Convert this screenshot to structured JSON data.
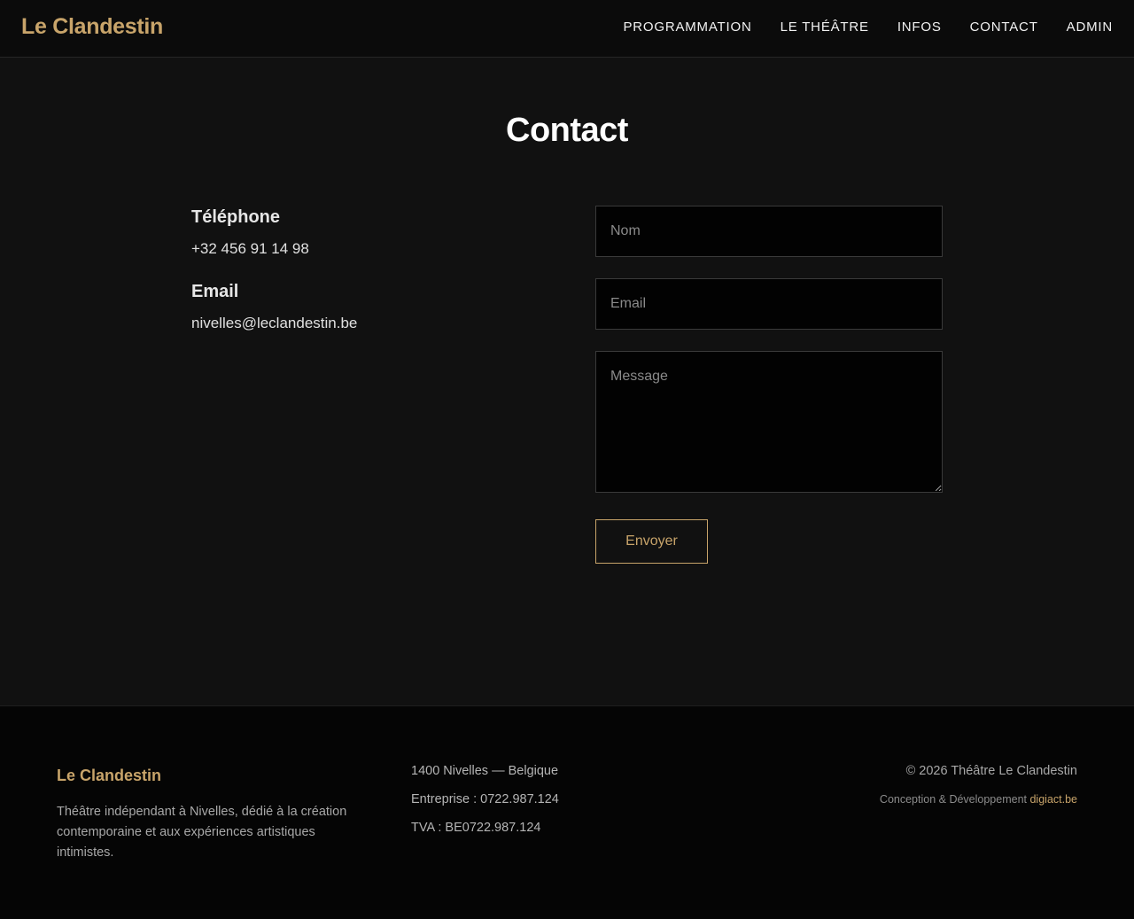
{
  "header": {
    "brand": "Le Clandestin",
    "nav": [
      "PROGRAMMATION",
      "LE THÉÂTRE",
      "INFOS",
      "CONTACT",
      "ADMIN"
    ]
  },
  "page": {
    "title": "Contact"
  },
  "contact_info": {
    "phone_heading": "Téléphone",
    "phone_value": "+32 456 91 14 98",
    "email_heading": "Email",
    "email_value": "nivelles@leclandestin.be"
  },
  "form": {
    "name_placeholder": "Nom",
    "email_placeholder": "Email",
    "message_placeholder": "Message",
    "submit_label": "Envoyer"
  },
  "footer": {
    "brand": "Le Clandestin",
    "description": "Théâtre indépendant à Nivelles, dédié à la création contemporaine et aux expériences artistiques intimistes.",
    "address": "1400 Nivelles — Belgique",
    "company": "Entreprise : 0722.987.124",
    "vat": "TVA : BE0722.987.124",
    "copyright": "© 2026 Théâtre Le Clandestin",
    "credits_prefix": "Conception & Développement",
    "credits_link": "digiact.be"
  },
  "colors": {
    "accent": "#c8a46a",
    "background": "#111111",
    "header_background": "#0b0b0b",
    "footer_background": "#050505",
    "input_background": "#020202"
  }
}
